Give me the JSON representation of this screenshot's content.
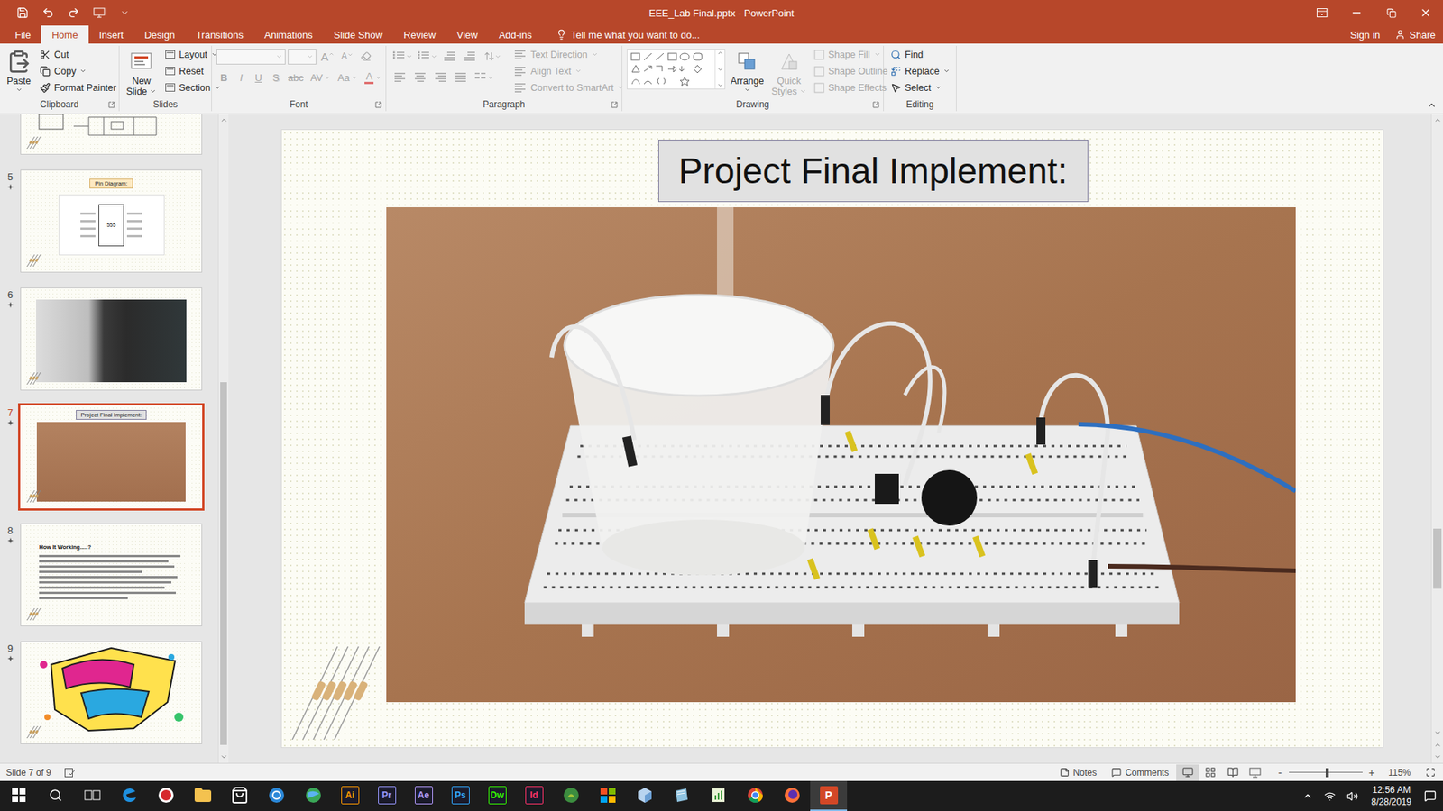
{
  "window": {
    "title": "EEE_Lab Final.pptx - PowerPoint"
  },
  "tabs": [
    {
      "label": "File",
      "selected": false
    },
    {
      "label": "Home",
      "selected": true
    },
    {
      "label": "Insert",
      "selected": false
    },
    {
      "label": "Design",
      "selected": false
    },
    {
      "label": "Transitions",
      "selected": false
    },
    {
      "label": "Animations",
      "selected": false
    },
    {
      "label": "Slide Show",
      "selected": false
    },
    {
      "label": "Review",
      "selected": false
    },
    {
      "label": "View",
      "selected": false
    },
    {
      "label": "Add-ins",
      "selected": false
    }
  ],
  "tell_me": {
    "placeholder": "Tell me what you want to do..."
  },
  "account": {
    "sign_in": "Sign in",
    "share": "Share"
  },
  "ribbon": {
    "clipboard": {
      "label": "Clipboard",
      "paste": "Paste",
      "commands": [
        {
          "label": "Cut",
          "dropdown": false,
          "disabled": false
        },
        {
          "label": "Copy",
          "dropdown": true,
          "disabled": false
        },
        {
          "label": "Format Painter",
          "dropdown": false,
          "disabled": false
        }
      ]
    },
    "slides": {
      "label": "Slides",
      "new_slide": [
        "New",
        "Slide"
      ],
      "commands": [
        {
          "label": "Layout",
          "dropdown": true
        },
        {
          "label": "Reset",
          "dropdown": false
        },
        {
          "label": "Section",
          "dropdown": true
        }
      ]
    },
    "font": {
      "label": "Font",
      "disabled": true,
      "grow": "A",
      "shrink": "A",
      "formats": [
        {
          "label": "B",
          "kind": "bold"
        },
        {
          "label": "I",
          "kind": "italic"
        },
        {
          "label": "U",
          "kind": "underline"
        },
        {
          "label": "S",
          "kind": "shadow"
        },
        {
          "label": "abc",
          "kind": "strike"
        },
        {
          "label": "AV",
          "kind": "spacing"
        },
        {
          "label": "Aa",
          "kind": "case"
        },
        {
          "label": "A",
          "kind": "color"
        }
      ]
    },
    "paragraph": {
      "label": "Paragraph",
      "disabled": true,
      "commands": [
        "Text Direction",
        "Align Text",
        "Convert to SmartArt"
      ]
    },
    "drawing": {
      "label": "Drawing",
      "arrange": "Arrange",
      "quick_styles": [
        "Quick",
        "Styles"
      ],
      "quick_styles_disabled": true,
      "commands": [
        "Shape Fill",
        "Shape Outline",
        "Shape Effects"
      ],
      "commands_disabled": true
    },
    "editing": {
      "label": "Editing",
      "commands": [
        {
          "label": "Find",
          "dropdown": false
        },
        {
          "label": "Replace",
          "dropdown": true
        },
        {
          "label": "Select",
          "dropdown": true
        }
      ]
    }
  },
  "thumbnails": [
    {
      "kind": "circuit",
      "animated": false,
      "selected": false
    },
    {
      "number": "5",
      "kind": "pin-diagram",
      "title": "Pin Diagram:",
      "chip": "555",
      "animated": true,
      "selected": false
    },
    {
      "number": "6",
      "kind": "photo",
      "animated": true,
      "selected": false
    },
    {
      "number": "7",
      "kind": "photo-title",
      "title": "Project Final Implement:",
      "animated": true,
      "selected": true
    },
    {
      "number": "8",
      "kind": "text",
      "title": "How It Working.....?",
      "animated": true,
      "selected": false
    },
    {
      "number": "9",
      "kind": "thanks",
      "animated": true,
      "selected": false
    }
  ],
  "thumbnail_scroll": {
    "thumb_offset": 0.41,
    "thumb_size": 0.58
  },
  "slide_scroll": {
    "thumb_offset": 0.67,
    "thumb_size": 0.1
  },
  "slide": {
    "title": "Project Final Implement:"
  },
  "status_bar": {
    "slide_info": "Slide 7 of 9",
    "notes": "Notes",
    "comments": "Comments",
    "views": [
      {
        "kind": "normal",
        "selected": true
      },
      {
        "kind": "sorter",
        "selected": false
      },
      {
        "kind": "reading",
        "selected": false
      },
      {
        "kind": "slideshow",
        "selected": false
      }
    ],
    "zoom": {
      "minus": "-",
      "plus": "+",
      "level": 0.52,
      "reading": "115%"
    }
  },
  "taskbar": {
    "apps": [
      {
        "kind": "start",
        "active": false
      },
      {
        "kind": "search",
        "active": false
      },
      {
        "kind": "taskview",
        "active": false
      },
      {
        "kind": "edge",
        "active": false
      },
      {
        "kind": "record",
        "active": false
      },
      {
        "kind": "explorer",
        "active": false
      },
      {
        "kind": "store",
        "active": false
      },
      {
        "kind": "app-blue",
        "active": false
      },
      {
        "kind": "globe",
        "active": false
      },
      {
        "kind": "letter",
        "label": "Ai",
        "color": "#ff9a00",
        "active": false
      },
      {
        "kind": "letter",
        "label": "Pr",
        "color": "#9999ff",
        "active": false
      },
      {
        "kind": "letter",
        "label": "Ae",
        "color": "#b59cff",
        "active": false
      },
      {
        "kind": "letter",
        "label": "Ps",
        "color": "#31a8ff",
        "active": false
      },
      {
        "kind": "letter",
        "label": "Dw",
        "color": "#35fa00",
        "active": false
      },
      {
        "kind": "letter",
        "label": "Id",
        "color": "#ff3366",
        "active": false
      },
      {
        "kind": "android",
        "active": false
      },
      {
        "kind": "tiles",
        "active": false
      },
      {
        "kind": "cube",
        "active": false
      },
      {
        "kind": "paper",
        "active": false
      },
      {
        "kind": "sheet",
        "active": false
      },
      {
        "kind": "chrome",
        "active": false
      },
      {
        "kind": "firefox",
        "active": false
      },
      {
        "kind": "office",
        "label": "P",
        "color": "#d24726",
        "active": true
      }
    ],
    "clock": {
      "time": "12:56 AM",
      "date": "8/28/2019"
    }
  }
}
